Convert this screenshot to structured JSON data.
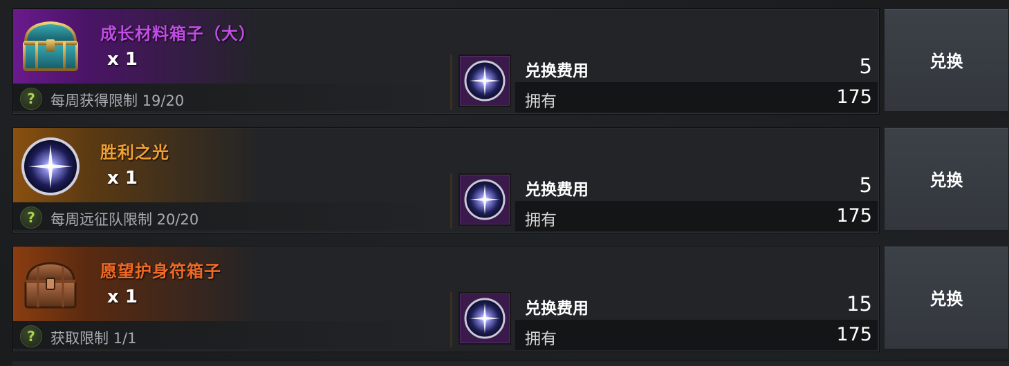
{
  "colors": {
    "purple_name": "#c24ce6",
    "orange_name": "#f0a033",
    "brown_name": "#ee6a26"
  },
  "items": [
    {
      "name": "成长材料箱子（大）",
      "name_color": "#c24ce6",
      "quantity": "x 1",
      "icon": "treasure-chest-teal-icon",
      "limit_text": "每周获得限制 19/20",
      "help_symbol": "?",
      "cost_label": "兑换费用",
      "cost_value": "5",
      "cost_icon": "light-orb-icon",
      "own_label": "拥有",
      "own_value": "175",
      "button_label": "兑换"
    },
    {
      "name": "胜利之光",
      "name_color": "#f0a033",
      "quantity": "x 1",
      "icon": "light-orb-icon",
      "limit_text": "每周远征队限制 20/20",
      "help_symbol": "?",
      "cost_label": "兑换费用",
      "cost_value": "5",
      "cost_icon": "light-orb-icon",
      "own_label": "拥有",
      "own_value": "175",
      "button_label": "兑换"
    },
    {
      "name": "愿望护身符箱子",
      "name_color": "#ee6a26",
      "quantity": "x 1",
      "icon": "wooden-chest-icon",
      "limit_text": "获取限制 1/1",
      "help_symbol": "?",
      "cost_label": "兑换费用",
      "cost_value": "15",
      "cost_icon": "light-orb-icon",
      "own_label": "拥有",
      "own_value": "175",
      "button_label": "兑换"
    }
  ]
}
